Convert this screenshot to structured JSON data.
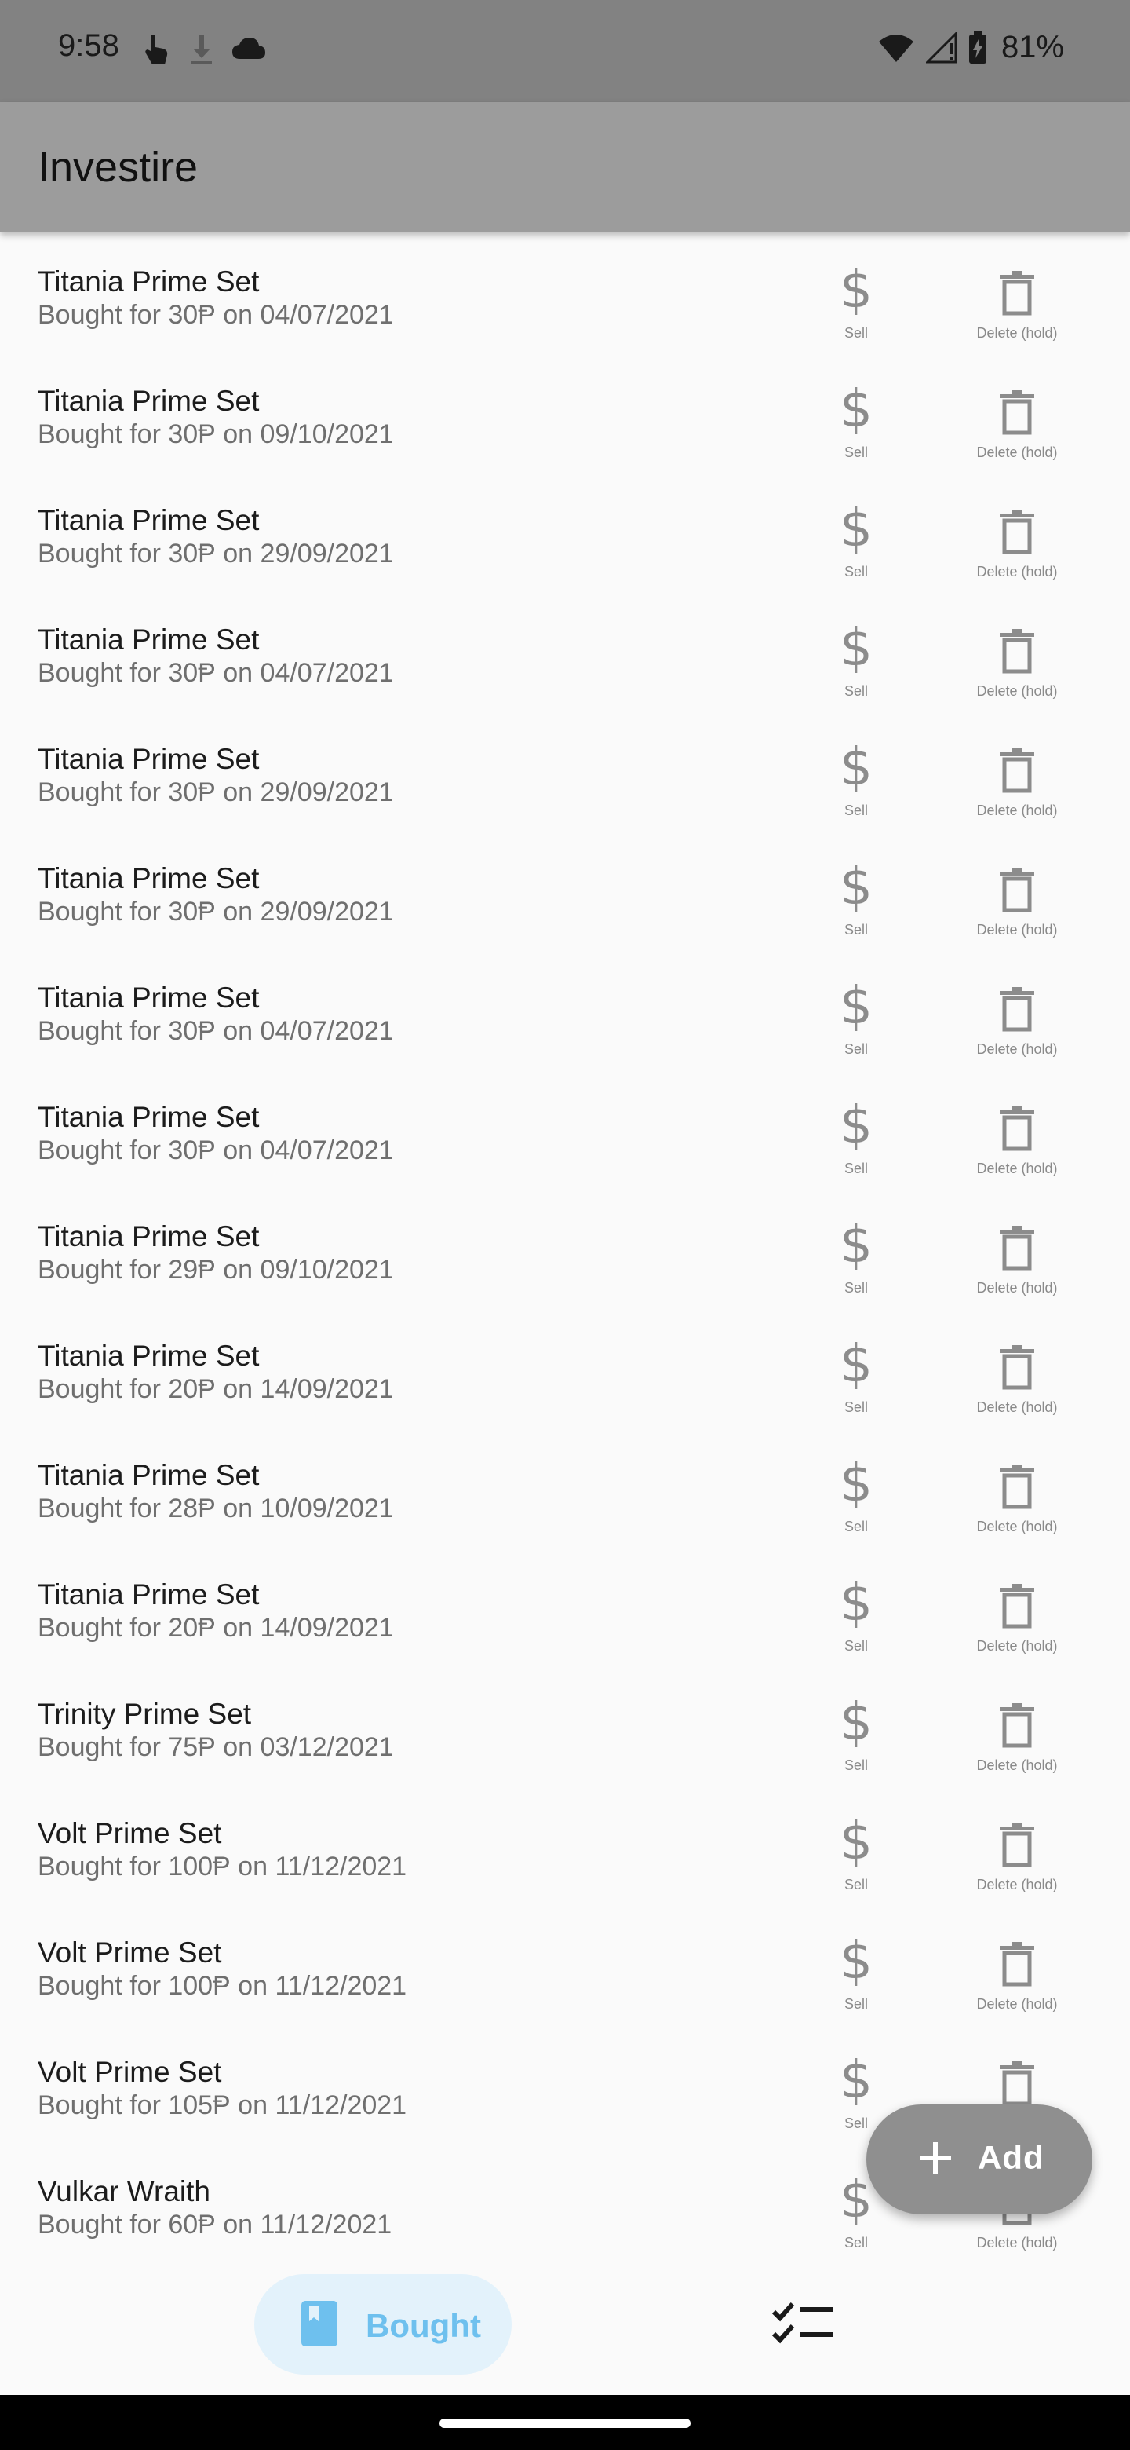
{
  "status_bar": {
    "time": "9:58",
    "battery": "81%",
    "left_icons": [
      "touch-icon",
      "download-icon",
      "cloud-icon"
    ],
    "right_icons": [
      "wifi-icon",
      "signal-icon",
      "battery-icon"
    ]
  },
  "app_bar": {
    "title": "Investire"
  },
  "labels": {
    "sell": "Sell",
    "delete": "Delete (hold)"
  },
  "items": [
    {
      "name": "Titania Prime Set",
      "detail": "Bought for 30Ᵽ on 04/07/2021"
    },
    {
      "name": "Titania Prime Set",
      "detail": "Bought for 30Ᵽ on 09/10/2021"
    },
    {
      "name": "Titania Prime Set",
      "detail": "Bought for 30Ᵽ on 29/09/2021"
    },
    {
      "name": "Titania Prime Set",
      "detail": "Bought for 30Ᵽ on 04/07/2021"
    },
    {
      "name": "Titania Prime Set",
      "detail": "Bought for 30Ᵽ on 29/09/2021"
    },
    {
      "name": "Titania Prime Set",
      "detail": "Bought for 30Ᵽ on 29/09/2021"
    },
    {
      "name": "Titania Prime Set",
      "detail": "Bought for 30Ᵽ on 04/07/2021"
    },
    {
      "name": "Titania Prime Set",
      "detail": "Bought for 30Ᵽ on 04/07/2021"
    },
    {
      "name": "Titania Prime Set",
      "detail": "Bought for 29Ᵽ on 09/10/2021"
    },
    {
      "name": "Titania Prime Set",
      "detail": "Bought for 20Ᵽ on 14/09/2021"
    },
    {
      "name": "Titania Prime Set",
      "detail": "Bought for 28Ᵽ on 10/09/2021"
    },
    {
      "name": "Titania Prime Set",
      "detail": "Bought for 20Ᵽ on 14/09/2021"
    },
    {
      "name": "Trinity Prime Set",
      "detail": "Bought for 75Ᵽ on 03/12/2021"
    },
    {
      "name": "Volt Prime Set",
      "detail": "Bought for 100Ᵽ on 11/12/2021"
    },
    {
      "name": "Volt Prime Set",
      "detail": "Bought for 100Ᵽ on 11/12/2021"
    },
    {
      "name": "Volt Prime Set",
      "detail": "Bought for 105Ᵽ on 11/12/2021"
    },
    {
      "name": "Vulkar Wraith",
      "detail": "Bought for 60Ᵽ on 11/12/2021"
    }
  ],
  "fab": {
    "label": "Add",
    "icon": "plus-icon"
  },
  "bottom_nav": {
    "bought_label": "Bought",
    "bought_icon": "bookmark-icon",
    "second_icon": "checklist-icon"
  },
  "colors": {
    "status_bar": "#828282",
    "app_bar": "#9c9c9c",
    "fab": "#8f8f8f",
    "nav_active_bg": "#e3f2fb",
    "nav_active_fg": "#6ec0ee",
    "icon_gray": "#8c8c8c"
  }
}
